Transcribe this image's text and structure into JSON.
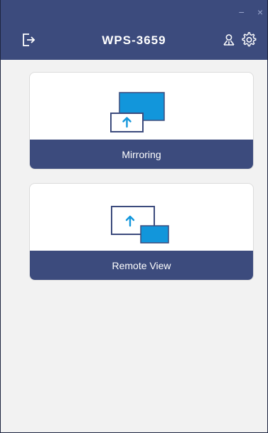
{
  "window": {
    "title": "WPS-3659",
    "minimize_glyph": "−",
    "close_glyph": "×"
  },
  "header": {
    "exit_icon": "exit-icon",
    "user_icon": "user-icon",
    "settings_icon": "gear-icon"
  },
  "cards": [
    {
      "label": "Mirroring",
      "icon": "mirroring-icon"
    },
    {
      "label": "Remote View",
      "icon": "remote-view-icon"
    }
  ],
  "colors": {
    "header_bg": "#3c4b7d",
    "screen_blue": "#1296db",
    "page_bg": "#f2f2f2"
  }
}
